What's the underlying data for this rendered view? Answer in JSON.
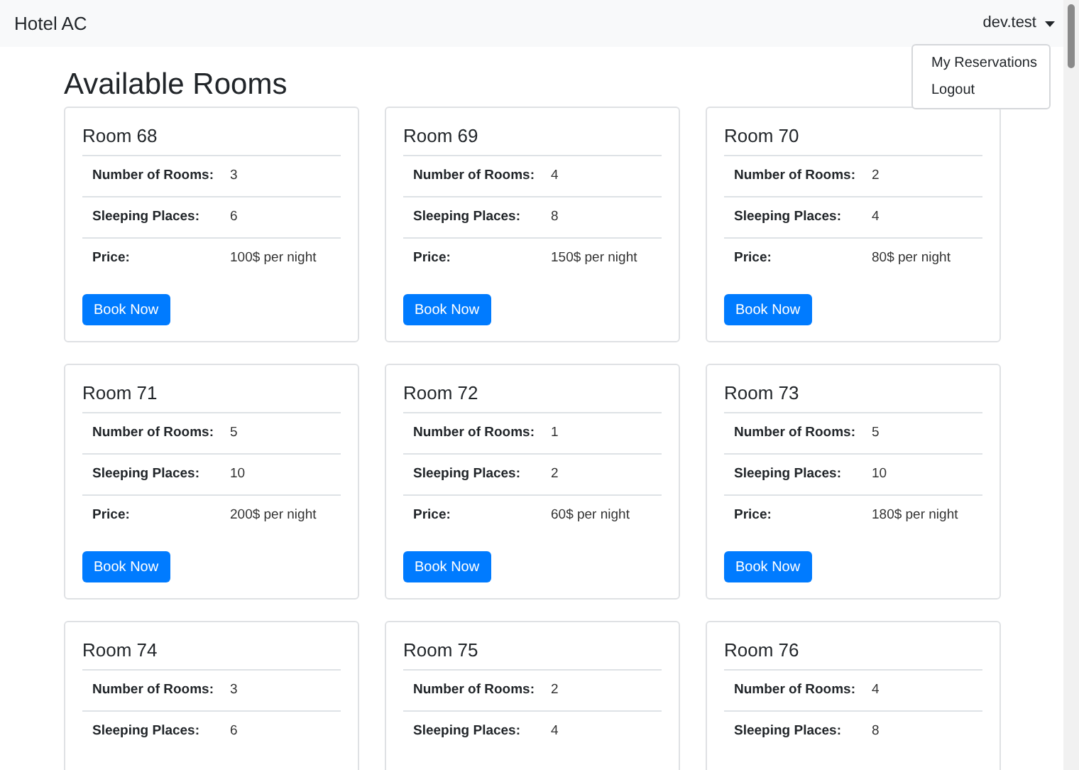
{
  "navbar": {
    "brand": "Hotel AC",
    "user_menu": {
      "label": "dev.test",
      "expanded": true,
      "items": [
        "My Reservations",
        "Logout"
      ]
    }
  },
  "heading": "Available Rooms",
  "rooms": [
    {
      "title": "Room 68",
      "fields": [
        {
          "label": "Number of Rooms:",
          "value": "3"
        },
        {
          "label": "Sleeping Places:",
          "value": "6"
        },
        {
          "label": "Price:",
          "value": "100$ per night"
        }
      ],
      "button": "Book Now"
    },
    {
      "title": "Room 69",
      "fields": [
        {
          "label": "Number of Rooms:",
          "value": "4"
        },
        {
          "label": "Sleeping Places:",
          "value": "8"
        },
        {
          "label": "Price:",
          "value": "150$ per night"
        }
      ],
      "button": "Book Now"
    },
    {
      "title": "Room 70",
      "fields": [
        {
          "label": "Number of Rooms:",
          "value": "2"
        },
        {
          "label": "Sleeping Places:",
          "value": "4"
        },
        {
          "label": "Price:",
          "value": "80$ per night"
        }
      ],
      "button": "Book Now"
    },
    {
      "title": "Room 71",
      "fields": [
        {
          "label": "Number of Rooms:",
          "value": "5"
        },
        {
          "label": "Sleeping Places:",
          "value": "10"
        },
        {
          "label": "Price:",
          "value": "200$ per night"
        }
      ],
      "button": "Book Now"
    },
    {
      "title": "Room 72",
      "fields": [
        {
          "label": "Number of Rooms:",
          "value": "1"
        },
        {
          "label": "Sleeping Places:",
          "value": "2"
        },
        {
          "label": "Price:",
          "value": "60$ per night"
        }
      ],
      "button": "Book Now"
    },
    {
      "title": "Room 73",
      "fields": [
        {
          "label": "Number of Rooms:",
          "value": "5"
        },
        {
          "label": "Sleeping Places:",
          "value": "10"
        },
        {
          "label": "Price:",
          "value": "180$ per night"
        }
      ],
      "button": "Book Now"
    },
    {
      "title": "Room 74",
      "fields": [
        {
          "label": "Number of Rooms:",
          "value": "3"
        },
        {
          "label": "Sleeping Places:",
          "value": "6"
        }
      ]
    },
    {
      "title": "Room 75",
      "fields": [
        {
          "label": "Number of Rooms:",
          "value": "2"
        },
        {
          "label": "Sleeping Places:",
          "value": "4"
        }
      ]
    },
    {
      "title": "Room 76",
      "fields": [
        {
          "label": "Number of Rooms:",
          "value": "4"
        },
        {
          "label": "Sleeping Places:",
          "value": "8"
        }
      ]
    }
  ]
}
